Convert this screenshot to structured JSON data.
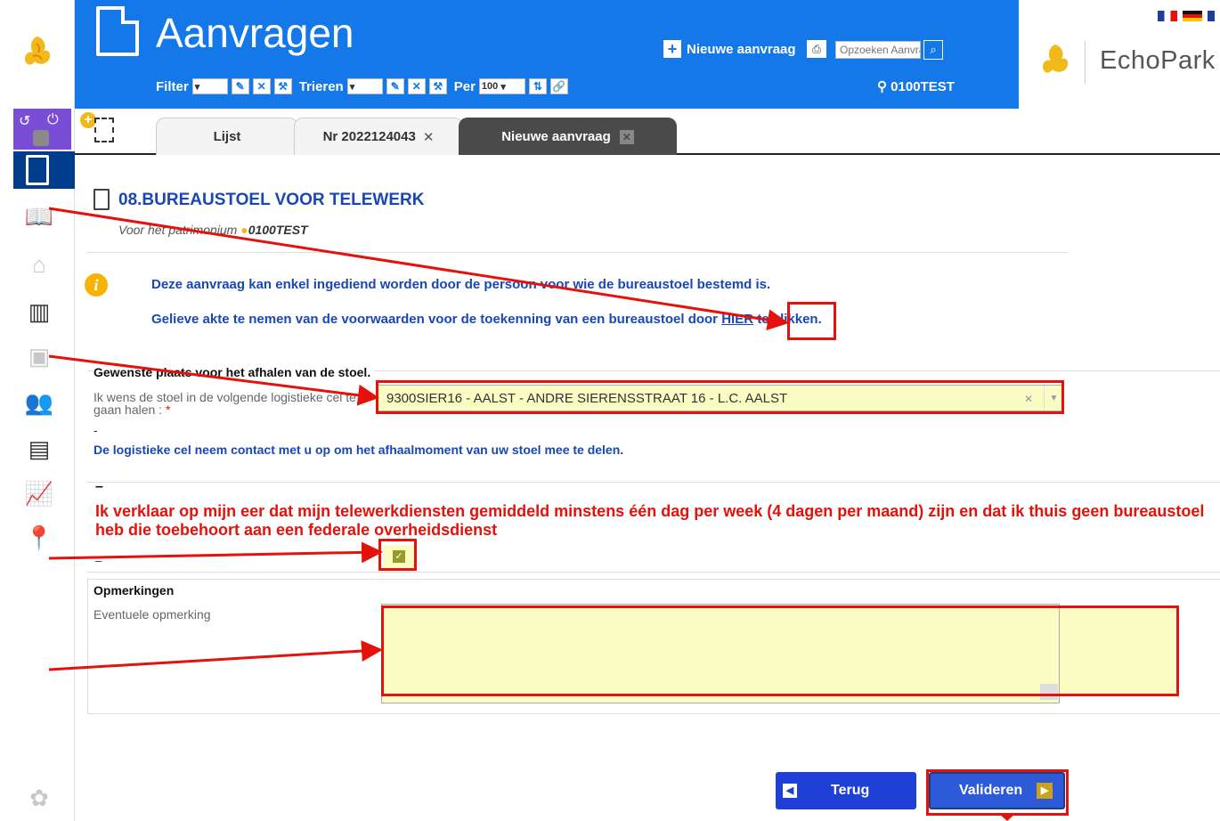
{
  "header": {
    "title": "Aanvragen",
    "filter_label": "Filter",
    "sort_label": "Trieren",
    "per_label": "Per",
    "per_value": "100",
    "new_request_label": "Nieuwe aanvraag",
    "search_placeholder": "Opzoeken Aanvraag",
    "location": "0100TEST",
    "brand": "EchoPark"
  },
  "tabs": [
    {
      "label": "Lijst"
    },
    {
      "label": "Nr 2022124043"
    },
    {
      "label": "Nieuwe aanvraag"
    }
  ],
  "form": {
    "title": "08.BUREAUSTOEL VOOR TELEWERK",
    "subtitle_prefix": "Voor het patrimonium",
    "subtitle_location": "0100TEST",
    "info_line_1": "Deze aanvraag kan enkel ingediend worden door de persoon voor wie de bureaustoel bestemd is.",
    "info_line_2_before": "Gelieve akte te nemen van de voorwaarden voor de toekenning van een bureaustoel door",
    "info_link": "HIER",
    "info_line_2_after": "te klikken.",
    "pickup_section": "Gewenste plaats voor het afhalen van de stoel.",
    "pickup_label": "Ik wens de stoel in de volgende logistieke cel te gaan halen :",
    "pickup_required": "*",
    "pickup_value": "9300SIER16 - AALST - ANDRE SIERENSSTRAAT 16 - L.C. AALST",
    "pickup_dash": "-",
    "pickup_note": "De logistieke cel neem contact met u op om het afhaalmoment van uw stoel mee te delen.",
    "declaration_dash": "–",
    "declaration": "Ik verklaar op mijn eer dat mijn telewerkdiensten gemiddeld minstens één dag per week (4 dagen per maand) zijn en dat ik thuis geen bureaustoel heb die toebehoort aan een federale overheidsdienst",
    "declaration_checked": true,
    "declaration_dash_2": "–",
    "remarks_section": "Opmerkingen",
    "remarks_label": "Eventuele opmerking",
    "back_label": "Terug",
    "validate_label": "Valideren"
  },
  "colors": {
    "header_blue": "#1478e8",
    "title_blue": "#1947b8",
    "warning_red": "#e3120b",
    "field_yellow": "#fbfbc4",
    "annotation_red": "#e3120b"
  }
}
